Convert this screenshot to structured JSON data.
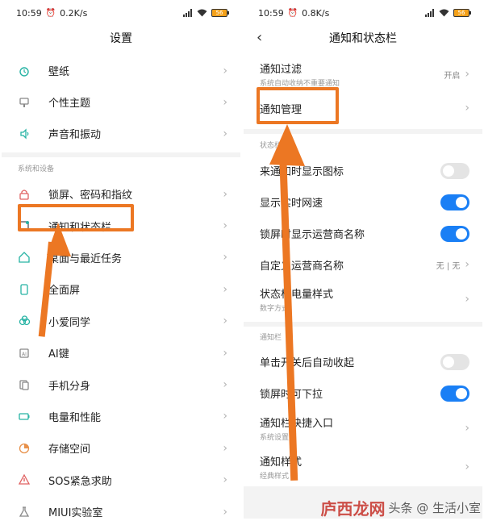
{
  "left": {
    "status": {
      "time": "10:59",
      "speed": "0.2K/s",
      "battery": "56"
    },
    "title": "设置",
    "items_top": [
      {
        "label": "壁纸",
        "icon": "wallpaper-icon"
      },
      {
        "label": "个性主题",
        "icon": "theme-icon"
      },
      {
        "label": "声音和振动",
        "icon": "sound-icon"
      }
    ],
    "section": "系统和设备",
    "items": [
      {
        "label": "锁屏、密码和指纹",
        "icon": "lock-icon"
      },
      {
        "label": "通知和状态栏",
        "icon": "notification-icon"
      },
      {
        "label": "桌面与最近任务",
        "icon": "home-icon"
      },
      {
        "label": "全面屏",
        "icon": "fullscreen-icon"
      },
      {
        "label": "小爱同学",
        "icon": "assistant-icon"
      },
      {
        "label": "AI键",
        "icon": "ai-key-icon"
      },
      {
        "label": "手机分身",
        "icon": "dual-icon"
      },
      {
        "label": "电量和性能",
        "icon": "battery-icon"
      },
      {
        "label": "存储空间",
        "icon": "storage-icon"
      },
      {
        "label": "SOS紧急求助",
        "icon": "sos-icon"
      },
      {
        "label": "MIUI实验室",
        "icon": "lab-icon"
      }
    ]
  },
  "right": {
    "status": {
      "time": "10:59",
      "speed": "0.8K/s",
      "battery": "56"
    },
    "title": "通知和状态栏",
    "filter": {
      "label": "通知过滤",
      "sub": "系统自动收纳不重要通知",
      "value": "开启"
    },
    "manage": {
      "label": "通知管理"
    },
    "section_status": "状态栏",
    "status_items": [
      {
        "label": "来通知时显示图标",
        "toggle": false
      },
      {
        "label": "显示实时网速",
        "toggle": true
      },
      {
        "label": "锁屏时显示运营商名称",
        "toggle": true
      }
    ],
    "carrier": {
      "label": "自定义运营商名称",
      "value": "无 | 无"
    },
    "battery_style": {
      "label": "状态栏电量样式",
      "sub": "数字方式"
    },
    "section_notif": "通知栏",
    "notif_items": [
      {
        "label": "单击开关后自动收起",
        "toggle": false
      },
      {
        "label": "锁屏时可下拉",
        "toggle": true
      }
    ],
    "shortcut": {
      "label": "通知栏快捷入口",
      "sub": "系统设置"
    },
    "style": {
      "label": "通知样式",
      "sub": "经典样式"
    }
  },
  "watermark": {
    "logo": "庐西龙网",
    "text": "头条 @ 生活小室"
  },
  "colors": {
    "accent": "#1a7ff5",
    "highlight": "#ec7723",
    "icon": "#27b3a4"
  }
}
